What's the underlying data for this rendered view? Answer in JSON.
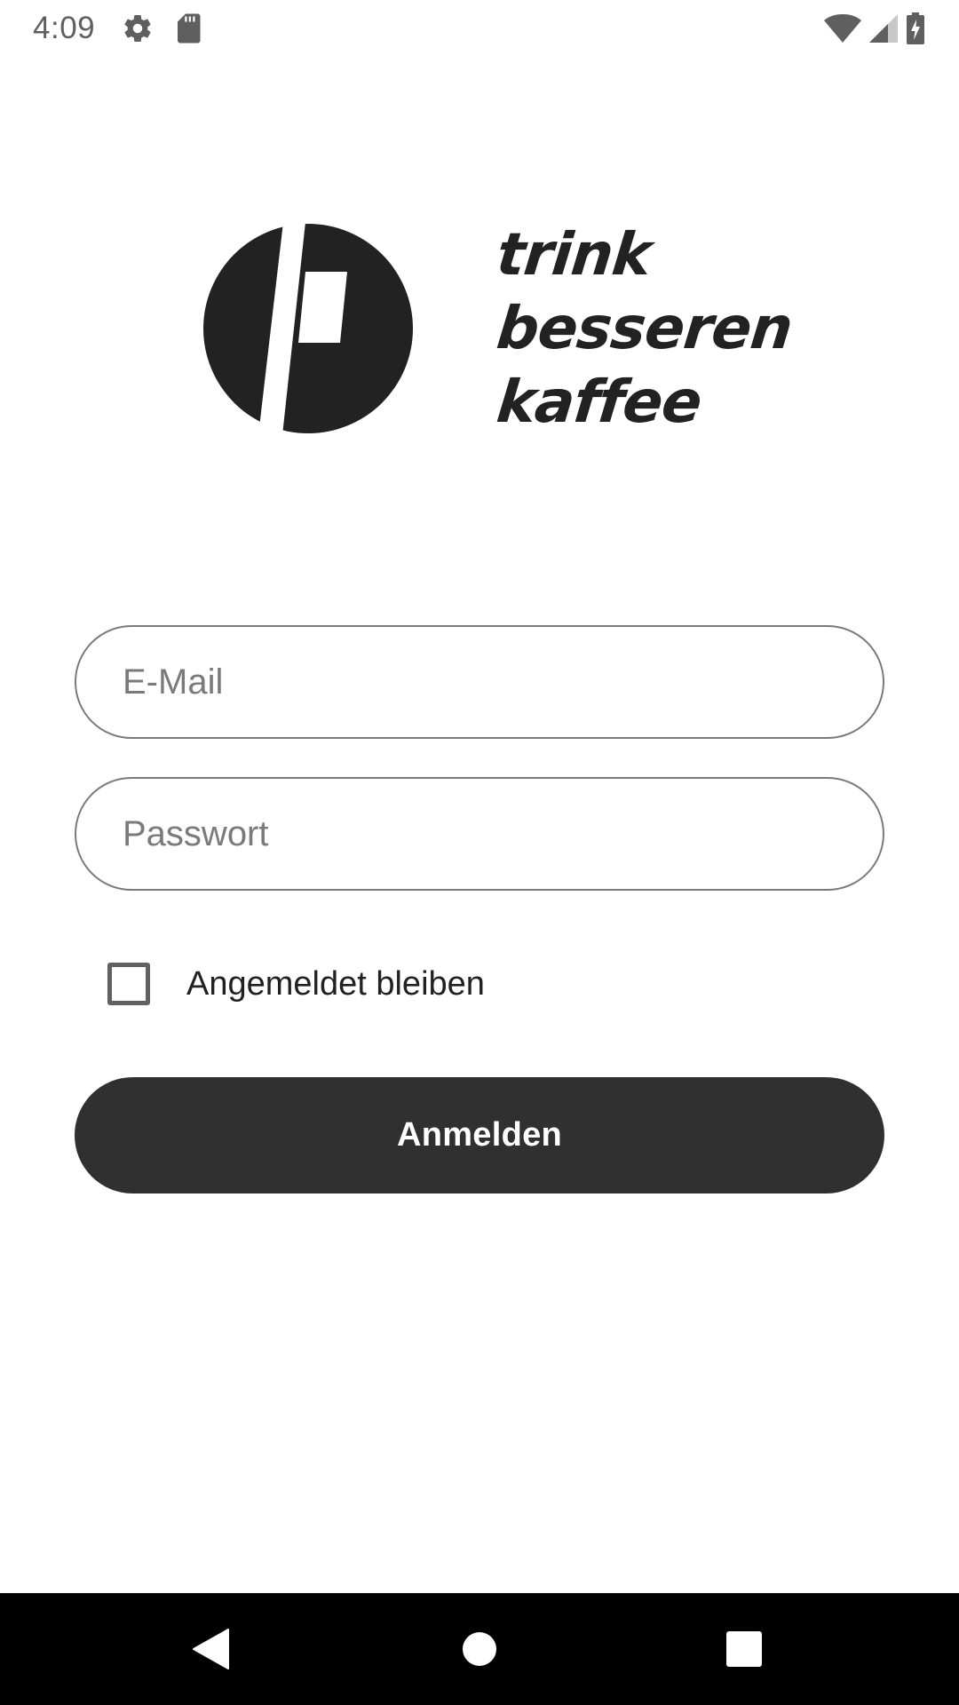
{
  "status_bar": {
    "time": "4:09",
    "left_icons": [
      "settings-gear-icon",
      "sd-card-icon"
    ],
    "right_icons": [
      "wifi-icon",
      "cell-signal-icon",
      "battery-charging-icon"
    ]
  },
  "logo": {
    "text_lines": [
      "trink",
      "besseren",
      "kaffee"
    ],
    "color": "#222222"
  },
  "form": {
    "email": {
      "placeholder": "E-Mail",
      "value": ""
    },
    "password": {
      "placeholder": "Passwort",
      "value": ""
    },
    "remember_me": {
      "label": "Angemeldet bleiben",
      "checked": false
    },
    "submit_label": "Anmelden"
  },
  "nav_bar": {
    "buttons": [
      "back-icon",
      "home-icon",
      "recents-icon"
    ]
  },
  "colors": {
    "button_bg": "#303030",
    "border": "#7a7a7a",
    "nav_bg": "#000000"
  }
}
